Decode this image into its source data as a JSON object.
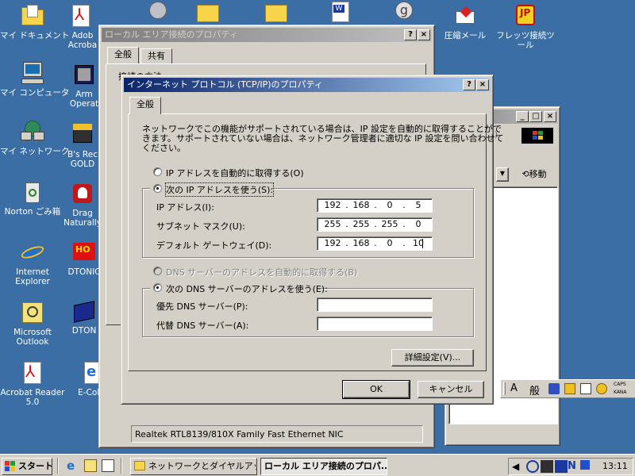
{
  "desktop": {
    "icons_left": [
      {
        "label": "マイ ドキュメント",
        "icon": "folder-documents-icon"
      },
      {
        "label": "マイ コンピュータ",
        "icon": "computer-icon"
      },
      {
        "label": "マイ ネットワーク",
        "icon": "network-icon"
      },
      {
        "label": "Norton ごみ箱",
        "icon": "recycle-bin-icon"
      },
      {
        "label": "Internet Explorer",
        "icon": "internet-explorer-icon"
      },
      {
        "label": "Microsoft Outlook",
        "icon": "outlook-icon"
      },
      {
        "label": "Acrobat Reader 5.0",
        "icon": "acrobat-icon"
      }
    ],
    "icons_col2": [
      {
        "label": "Adob Acroba",
        "icon": "acrobat-icon"
      },
      {
        "label": "Arm Operat",
        "icon": "app-icon"
      },
      {
        "label": "B's Rec GOLD",
        "icon": "cd-writer-icon"
      },
      {
        "label": "Drag Naturally",
        "icon": "dragon-icon"
      },
      {
        "label": "DTONIC",
        "icon": "dtonic-icon"
      },
      {
        "label": "DTON",
        "icon": "books-icon"
      },
      {
        "label": "E-Color",
        "icon": "ecolor-icon"
      }
    ],
    "icons_right": [
      {
        "label": "圧縮メール",
        "icon": "mail-compress-icon"
      },
      {
        "label": "フレッツ接続ツール",
        "icon": "flets-icon"
      }
    ]
  },
  "lan_window": {
    "title": "ローカル エリア接続のプロパティ",
    "tabs": [
      "全般",
      "共有"
    ],
    "connect_label": "接続の方法:",
    "adapter": "Realtek RTL8139/810X Family Fast Ethernet NIC"
  },
  "bg_window": {
    "go_label": "移動",
    "menu_fragment": "(A)"
  },
  "tcpip_dialog": {
    "title": "インターネット プロトコル (TCP/IP)のプロパティ",
    "tab": "全般",
    "description": [
      "ネットワークでこの機能がサポートされている場合は、IP 設定を自動的に取得することがで",
      "きます。サポートされていない場合は、ネットワーク管理者に適切な IP 設定を問い合わせて",
      "ください。"
    ],
    "ip_auto": "IP アドレスを自動的に取得する(O)",
    "ip_manual": "次の IP アドレスを使う(S):",
    "fields": [
      {
        "label": "IP アドレス(I):",
        "octets": [
          "192",
          "168",
          "0",
          "5"
        ]
      },
      {
        "label": "サブネット マスク(U):",
        "octets": [
          "255",
          "255",
          "255",
          "0"
        ]
      },
      {
        "label": "デフォルト ゲートウェイ(D):",
        "octets": [
          "192",
          "168",
          "0",
          "10"
        ]
      }
    ],
    "dns_auto": "DNS サーバーのアドレスを自動的に取得する(B)",
    "dns_manual": "次の DNS サーバーのアドレスを使う(E):",
    "dns_pref": "優先 DNS サーバー(P):",
    "dns_alt": "代替 DNS サーバー(A):",
    "advanced": "詳細設定(V)...",
    "ok": "OK",
    "cancel": "キャンセル",
    "help_btn": "?",
    "close_btn": "×"
  },
  "ime_bar": {
    "mode": "般",
    "caps": "CAPS",
    "kana": "KANA"
  },
  "taskbar": {
    "start": "スタート",
    "task1": "ネットワークとダイヤルアップ...",
    "task2": "ローカル エリア接続のプロパ...",
    "clock": "13:11"
  },
  "colors": {
    "desktop": "#3a6ea5",
    "titlebar_active": "#0a246a",
    "face": "#d4d0c8"
  }
}
